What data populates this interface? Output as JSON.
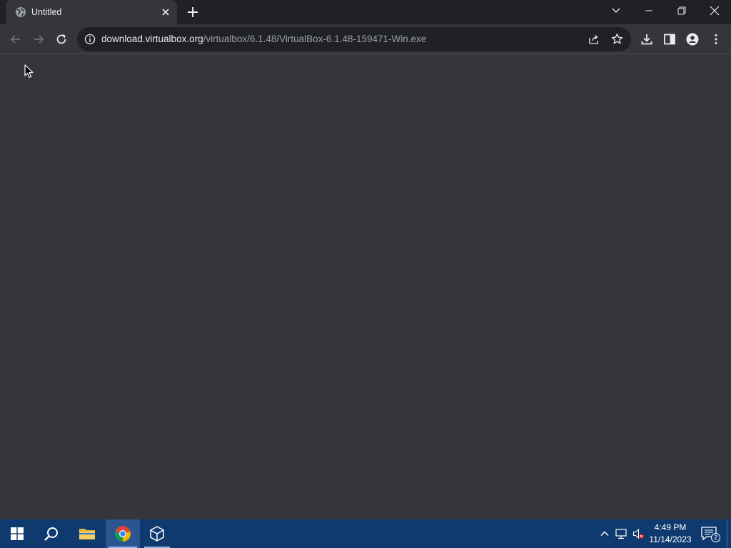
{
  "tab": {
    "title": "Untitled"
  },
  "omnibox": {
    "host": "download.virtualbox.org",
    "path": "/virtualbox/6.1.48/VirtualBox-6.1.48-159471-Win.exe"
  },
  "taskbar": {
    "time": "4:49 PM",
    "date": "11/14/2023",
    "notification_count": "2"
  },
  "colors": {
    "tabstrip": "#202124",
    "toolbar": "#35363a",
    "omnibox": "#202124",
    "taskbar": "#0f3a70"
  }
}
